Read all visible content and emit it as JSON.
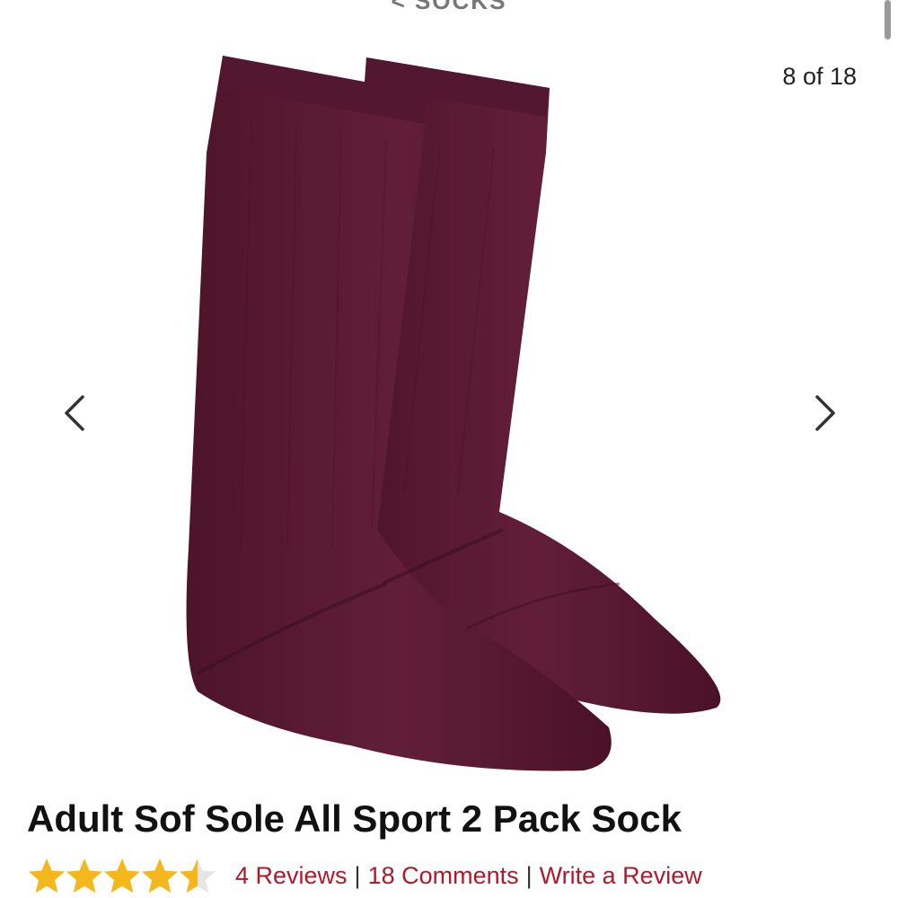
{
  "breadcrumb": {
    "label": "< SOCKS"
  },
  "gallery": {
    "counter": "8 of 18",
    "current": 8,
    "total": 18,
    "image_description": "pair of maroon knee-high socks",
    "sock_color": "#5b1a33"
  },
  "product": {
    "title": "Adult Sof Sole All Sport 2 Pack Sock",
    "rating": 4.5,
    "rating_max": 5,
    "star_color": "#f5b81c",
    "reviews_label": "4 Reviews",
    "comments_label": "18 Comments",
    "write_review_label": "Write a Review",
    "separator": "|",
    "link_color": "#b0192a"
  }
}
